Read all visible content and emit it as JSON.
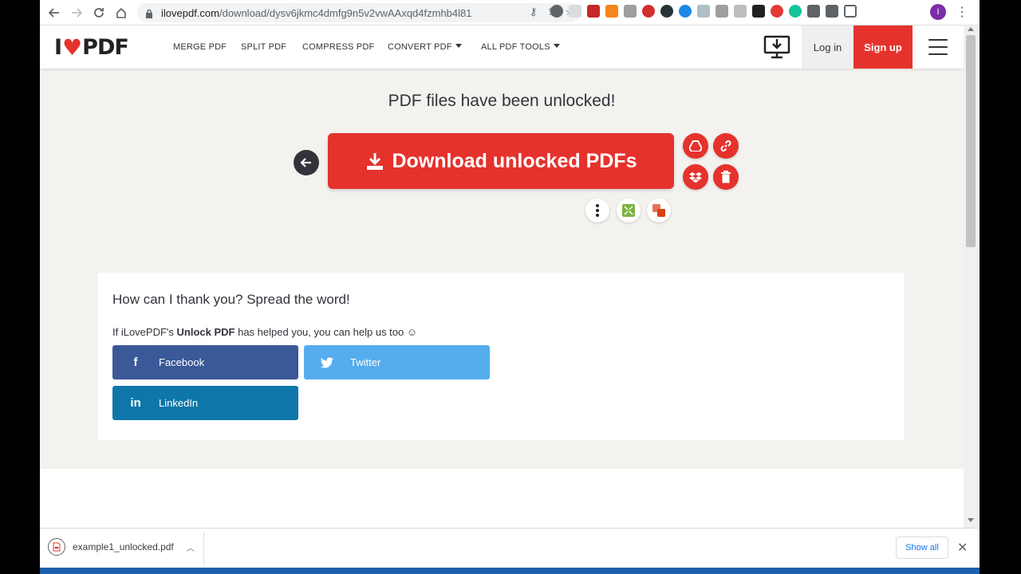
{
  "browser": {
    "url_host": "ilovepdf.com",
    "url_path": "/download/dysv6jkmc4dmfg9n5v2vwAAxqd4fzmhb4l816...",
    "profile_initial": "I"
  },
  "site": {
    "logo_left": "I",
    "logo_right": "PDF",
    "nav": {
      "merge": "MERGE PDF",
      "split": "SPLIT PDF",
      "compress": "COMPRESS PDF",
      "convert": "CONVERT PDF",
      "all_tools": "ALL PDF TOOLS"
    },
    "login": "Log in",
    "signup": "Sign up"
  },
  "main": {
    "title": "PDF files have been unlocked!",
    "download_label": "Download unlocked PDFs"
  },
  "share": {
    "title": "How can I thank you? Spread the word!",
    "text_prefix": "If iLovePDF's ",
    "text_bold": "Unlock PDF",
    "text_suffix": " has helped you, you can help us too ☺",
    "facebook": "Facebook",
    "twitter": "Twitter",
    "linkedin": "LinkedIn"
  },
  "download_shelf": {
    "file_name": "example1_unlocked.pdf",
    "show_all": "Show all"
  },
  "colors": {
    "brand_red": "#e5322d",
    "facebook": "#3b5998",
    "twitter": "#55acee",
    "linkedin": "#0e76a8"
  }
}
